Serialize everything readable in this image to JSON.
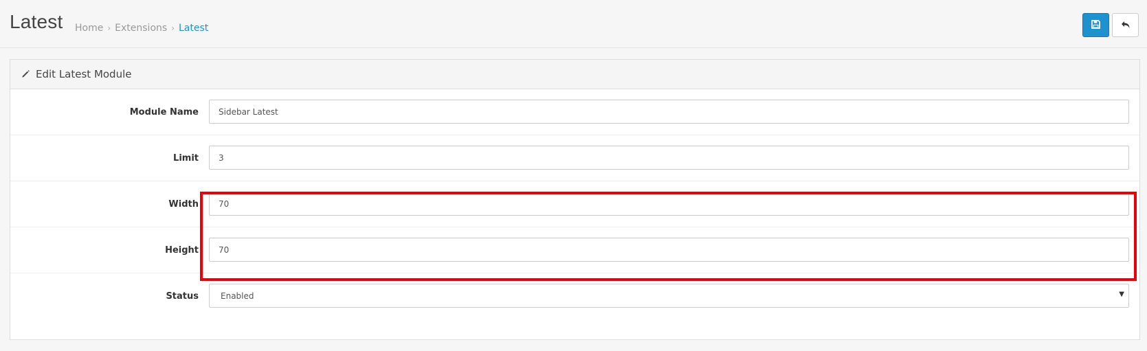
{
  "header": {
    "title": "Latest",
    "breadcrumb": [
      "Home",
      "Extensions",
      "Latest"
    ],
    "breadcrumb_separator": "›",
    "save_icon": "save-icon",
    "back_icon": "reply-icon"
  },
  "panel": {
    "heading_icon": "pencil-icon",
    "heading": "Edit Latest Module"
  },
  "form": {
    "module_name": {
      "label": "Module Name",
      "value": "Sidebar Latest"
    },
    "limit": {
      "label": "Limit",
      "value": "3"
    },
    "width": {
      "label": "Width",
      "value": "70"
    },
    "height": {
      "label": "Height",
      "value": "70"
    },
    "status": {
      "label": "Status",
      "value": "Enabled"
    }
  },
  "colors": {
    "primary": "#1e91cf",
    "highlight": "#e8000b"
  }
}
